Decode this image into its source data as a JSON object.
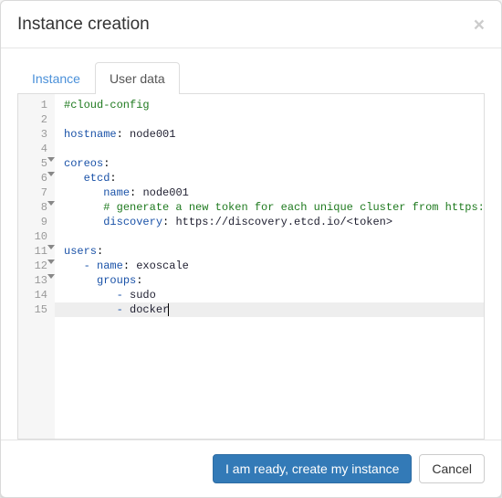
{
  "modal": {
    "title": "Instance creation",
    "close_label": "×"
  },
  "tabs": [
    {
      "label": "Instance",
      "active": false
    },
    {
      "label": "User data",
      "active": true
    }
  ],
  "code": {
    "lines": [
      {
        "n": 1,
        "fold": false,
        "tokens": [
          {
            "cls": "tok-str",
            "t": "#cloud-config"
          }
        ]
      },
      {
        "n": 2,
        "fold": false,
        "tokens": []
      },
      {
        "n": 3,
        "fold": false,
        "tokens": [
          {
            "cls": "tok-key",
            "t": "hostname"
          },
          {
            "cls": "",
            "t": ": "
          },
          {
            "cls": "tok-val",
            "t": "node001"
          }
        ]
      },
      {
        "n": 4,
        "fold": false,
        "tokens": []
      },
      {
        "n": 5,
        "fold": true,
        "tokens": [
          {
            "cls": "tok-key",
            "t": "coreos"
          },
          {
            "cls": "",
            "t": ":"
          }
        ]
      },
      {
        "n": 6,
        "fold": true,
        "tokens": [
          {
            "cls": "",
            "t": "   "
          },
          {
            "cls": "tok-key",
            "t": "etcd"
          },
          {
            "cls": "",
            "t": ":"
          }
        ]
      },
      {
        "n": 7,
        "fold": false,
        "tokens": [
          {
            "cls": "",
            "t": "      "
          },
          {
            "cls": "tok-key",
            "t": "name"
          },
          {
            "cls": "",
            "t": ": "
          },
          {
            "cls": "tok-val",
            "t": "node001"
          }
        ]
      },
      {
        "n": 8,
        "fold": true,
        "tokens": [
          {
            "cls": "",
            "t": "      "
          },
          {
            "cls": "tok-str",
            "t": "# generate a new token for each unique cluster from https://discover"
          }
        ]
      },
      {
        "n": 9,
        "fold": false,
        "tokens": [
          {
            "cls": "",
            "t": "      "
          },
          {
            "cls": "tok-key",
            "t": "discovery"
          },
          {
            "cls": "",
            "t": ": "
          },
          {
            "cls": "tok-val",
            "t": "https://discovery.etcd.io/<token>"
          }
        ]
      },
      {
        "n": 10,
        "fold": false,
        "tokens": []
      },
      {
        "n": 11,
        "fold": true,
        "tokens": [
          {
            "cls": "tok-key",
            "t": "users"
          },
          {
            "cls": "",
            "t": ":"
          }
        ]
      },
      {
        "n": 12,
        "fold": true,
        "tokens": [
          {
            "cls": "",
            "t": "   "
          },
          {
            "cls": "tok-dash",
            "t": "- "
          },
          {
            "cls": "tok-key",
            "t": "name"
          },
          {
            "cls": "",
            "t": ": "
          },
          {
            "cls": "tok-val",
            "t": "exoscale"
          }
        ]
      },
      {
        "n": 13,
        "fold": true,
        "tokens": [
          {
            "cls": "",
            "t": "     "
          },
          {
            "cls": "tok-key",
            "t": "groups"
          },
          {
            "cls": "",
            "t": ":"
          }
        ]
      },
      {
        "n": 14,
        "fold": false,
        "tokens": [
          {
            "cls": "",
            "t": "        "
          },
          {
            "cls": "tok-dash",
            "t": "- "
          },
          {
            "cls": "tok-val",
            "t": "sudo"
          }
        ]
      },
      {
        "n": 15,
        "fold": false,
        "active": true,
        "tokens": [
          {
            "cls": "",
            "t": "        "
          },
          {
            "cls": "tok-dash",
            "t": "- "
          },
          {
            "cls": "tok-val",
            "t": "docker"
          }
        ],
        "cursor": true
      }
    ]
  },
  "footer": {
    "confirm_label": "I am ready, create my instance",
    "cancel_label": "Cancel"
  }
}
